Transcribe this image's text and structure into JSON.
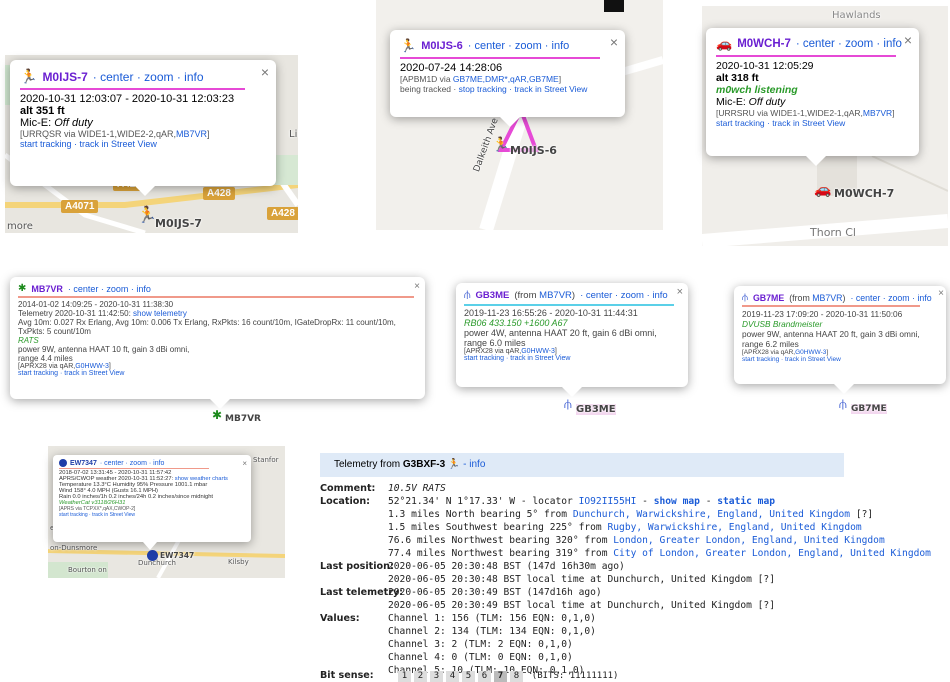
{
  "p1": {
    "callsign": "M0IJS-7",
    "nav": "· center · zoom · info",
    "times": "2020-10-31 12:03:07 - 2020-10-31 12:03:23",
    "alt": "alt 351 ft",
    "mic": "Mic-E: ",
    "mic_status": "Off duty",
    "path_prefix": "[URRQSR via WIDE1-1,WIDE2-2,qAR,",
    "path_link": "MB7VR",
    "path_suffix": "]",
    "actions": "start tracking · track in Street View",
    "map_label": "M0IJS-7",
    "roads": [
      "A4071",
      "A426",
      "A428",
      "A428"
    ],
    "places": [
      "Lilbo",
      "more"
    ]
  },
  "p2": {
    "callsign": "M0IJS-6",
    "nav": "· center · zoom · info",
    "time": "2020-07-24 14:28:06",
    "path_prefix": "[APBM1D via ",
    "path_link": "GB7ME,DMR*,qAR,GB7ME",
    "path_suffix": "]",
    "actions_prefix": "being tracked · ",
    "actions_link": "stop tracking · track in Street View",
    "map_label": "M0IJS-6",
    "street": "Dalkeith Ave"
  },
  "p3": {
    "callsign": "M0WCH-7",
    "nav": "· center · zoom · info",
    "time": "2020-10-31 12:05:29",
    "alt": "alt 318 ft",
    "status": "m0wch listening",
    "mic": "Mic-E: ",
    "mic_status": "Off duty",
    "path_prefix": "[URRSRU via WIDE1-1,WIDE2-1,qAR,",
    "path_link": "MB7VR",
    "path_suffix": "]",
    "actions": "start tracking · track in Street View",
    "map_label": "M0WCH-7",
    "street": "Thorn Cl",
    "street_top": "Hawlands"
  },
  "p4": {
    "callsign": "MB7VR",
    "nav": "· center · zoom · info",
    "times": "2014-01-02 14:09:25 - 2020-10-31 11:38:30",
    "telemetry_prefix": "Telemetry 2020-10-31 11:42:50: ",
    "telemetry_link": "show telemetry",
    "telemetry_line2": "Avg 10m: 0.027 Rx Erlang, Avg 10m: 0.006 Tx Erlang, RxPkts: 16 count/10m, IGateDropRx: 11 count/10m,",
    "telemetry_line3": "TxPkts: 5 count/10m",
    "comment": "RATS",
    "power": "power 9W, antenna HAAT 10 ft, gain 3 dBi omni,",
    "range": "range 4.4 miles",
    "path_prefix": "[APRX28 via qAR,",
    "path_link": "G0HWW-3",
    "path_suffix": "]",
    "actions": "start tracking · track in Street View",
    "map_label": "MB7VR"
  },
  "p5": {
    "callsign": "GB3ME",
    "from_prefix": " (from ",
    "from_link": "MB7VR",
    "from_suffix": ")",
    "nav": "· center · zoom · info",
    "times": "2019-11-23 16:55:26 - 2020-10-31 11:44:31",
    "comment": "RB06 433.150 +1600 A67",
    "power": "power 4W, antenna HAAT 20 ft, gain 6 dBi omni,",
    "range": "range 6.0 miles",
    "path_prefix": "[APRX28 via qAR,",
    "path_link": "G0HWW-3",
    "path_suffix": "]",
    "actions": "start tracking · track in Street View",
    "map_label": "GB3ME"
  },
  "p6": {
    "callsign": "GB7ME",
    "from_prefix": " (from ",
    "from_link": "MB7VR",
    "from_suffix": ")",
    "nav": "· center · zoom · info",
    "times": "2019-11-23 17:09:20 - 2020-10-31 11:50:06",
    "comment": "DVUSB Brandmeister",
    "power": "power 9W, antenna HAAT 20 ft, gain 3 dBi omni,",
    "range": "range 6.2 miles",
    "path_prefix": "[APRX28 via qAR,",
    "path_link": "G0HWW-3",
    "path_suffix": "]",
    "actions": "start tracking · track in Street View",
    "map_label": "GB7ME"
  },
  "p7": {
    "callsign": "EW7347",
    "nav": "· center · zoom · info",
    "times": "2018-07-02 13:31:45 - 2020-10-31 11:57:42",
    "weather_prefix": "APRS/CWOP weather 2020-10-31 11:52:27: ",
    "weather_link": "show weather charts",
    "temp": "Temperature 13.3°C Humidity 95% Pressure 1001.1 mbar",
    "wind": "Wind 158° 4.0 MPH (Gusts 16.1 MPH)",
    "rain": "Rain 0.0 inches/1h 0.2 inches/24h 0.2 inches/since midnight",
    "station": "WeatherCat v3118/26H31",
    "path": "[APRS via TCPXX*,qAX,CWOP-2]",
    "actions": "start tracking · track in Street View",
    "map_label": "EW7347",
    "places": [
      "Stanfor",
      "Dunchurch",
      "Kilsby",
      "on-Dunsmore",
      "Bourton on",
      "ethorpe"
    ]
  },
  "tele": {
    "header_prefix": "Telemetry from ",
    "header_call": "G3BXF-3",
    "header_suffix": " - info",
    "comment_label": "Comment:",
    "comment": "10.5V RATS",
    "location_label": "Location:",
    "loc_coords": "52°21.34' N 1°17.33' W - locator ",
    "loc_locator": "IO92II55HI",
    "loc_sep": " - ",
    "loc_showmap": "show map",
    "loc_sep2": " - ",
    "loc_static": "static map",
    "loc_lines": [
      {
        "dist": "1.3 miles North bearing 5° from ",
        "place": "Dunchurch, Warwickshire, England, United Kingdom",
        "tail": " [?]"
      },
      {
        "dist": "1.5 miles Southwest bearing 225° from ",
        "place": "Rugby, Warwickshire, England, United Kingdom",
        "tail": ""
      },
      {
        "dist": "76.6 miles Northwest bearing 320° from ",
        "place": "London, Greater London, England, United Kingdom",
        "tail": ""
      },
      {
        "dist": "77.4 miles Northwest bearing 319° from ",
        "place": "City of London, Greater London, England, United Kingdom",
        "tail": ""
      }
    ],
    "last_pos_label": "Last position:",
    "last_pos_1": "2020-06-05 20:30:48 BST (147d 16h30m ago)",
    "last_pos_2": "2020-06-05 20:30:48 BST local time at Dunchurch, United Kingdom [?]",
    "last_tel_label": "Last telemetry:",
    "last_tel_1": "2020-06-05 20:30:49 BST (147d16h ago)",
    "last_tel_2": "2020-06-05 20:30:49 BST local time at Dunchurch, United Kingdom [?]",
    "values_label": "Values:",
    "values": [
      "Channel 1: 156 (TLM: 156 EQN: 0,1,0)",
      "Channel 2: 134 (TLM: 134 EQN: 0,1,0)",
      "Channel 3: 2 (TLM: 2 EQN: 0,1,0)",
      "Channel 4: 0 (TLM: 0 EQN: 0,1,0)",
      "Channel 5: 10 (TLM: 10 EQN: 0,1,0)"
    ],
    "bits_label": "Bit sense:",
    "bits": [
      "1",
      "2",
      "3",
      "4",
      "5",
      "6",
      "7",
      "8"
    ],
    "bits_text": "(BITS: 11111111)"
  },
  "close_symbol": "×"
}
